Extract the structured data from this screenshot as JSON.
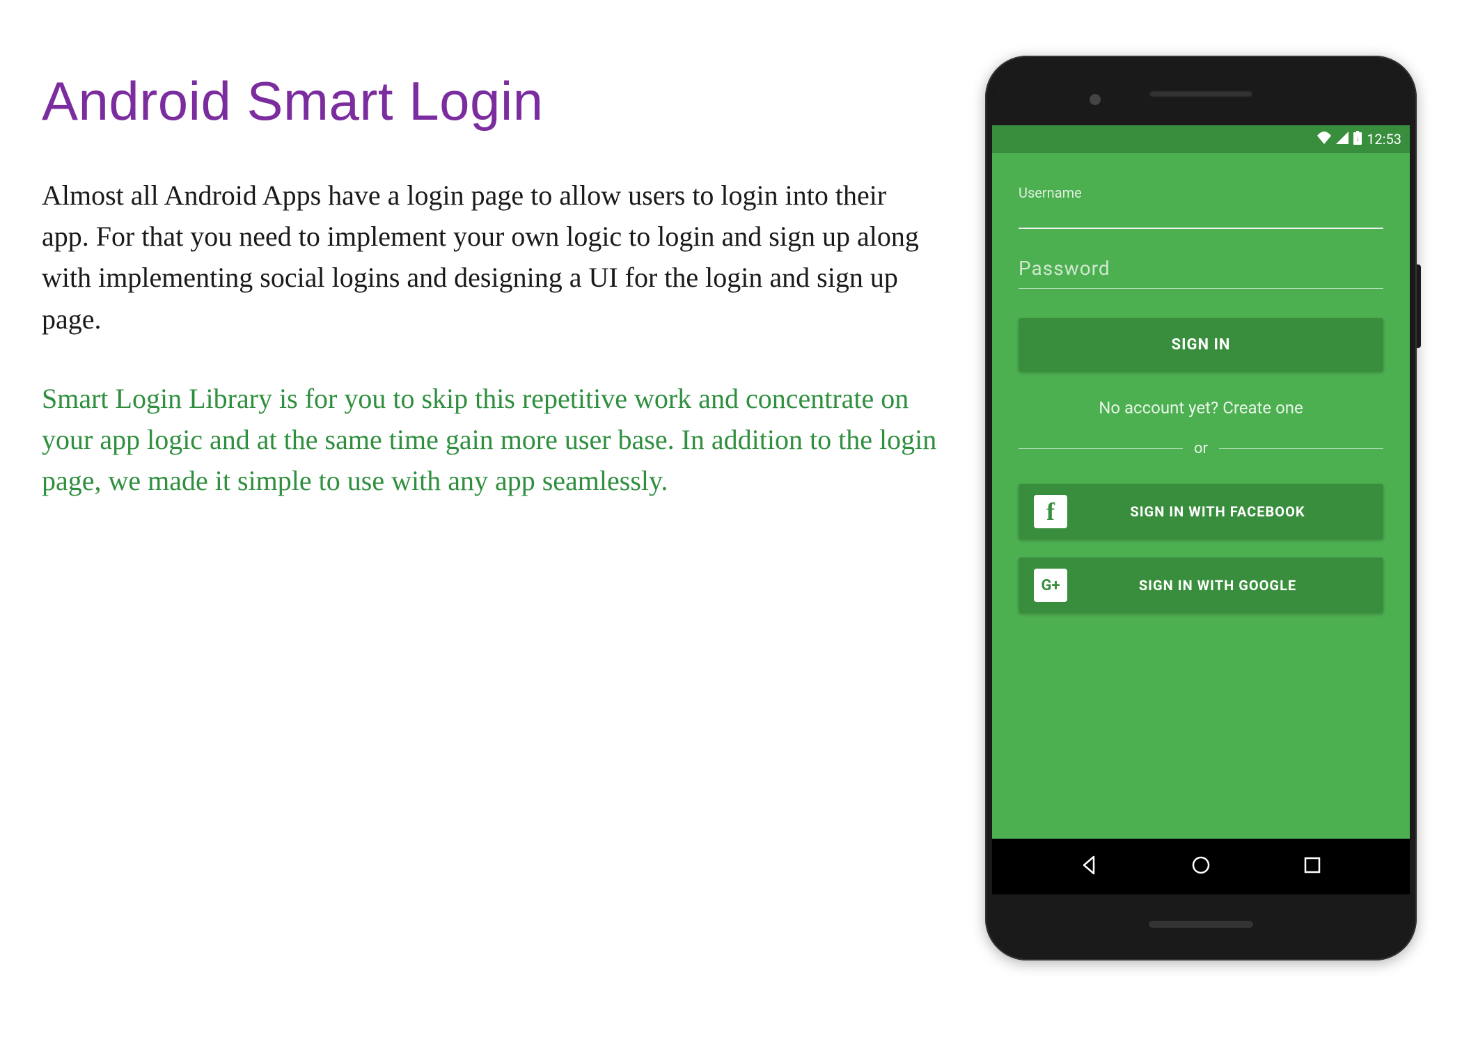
{
  "title": "Android Smart Login",
  "para1": "Almost all Android Apps have a login page to allow users to login into their app. For that you need to implement your own logic to login and sign up along with implementing social logins and designing a UI for the login and sign up page.",
  "para2": "Smart Login Library is for you to skip this repetitive work and concentrate on your app logic and at the same time gain more user base. In addition to the login page, we made it simple to use with any app seamlessly.",
  "phone": {
    "status_time": "12:53",
    "login": {
      "username_label": "Username",
      "password_placeholder": "Password",
      "signin_label": "SIGN IN",
      "create_account_text": "No account yet? Create one",
      "divider_text": "or",
      "facebook_label": "SIGN IN WITH FACEBOOK",
      "google_label": "SIGN IN WITH GOOGLE",
      "facebook_icon_letter": "f",
      "google_icon_text": "G+"
    }
  },
  "colors": {
    "title": "#7b2c9e",
    "accent_green": "#2f8f3e",
    "app_bg": "#4CAF50",
    "app_dark": "#388E3C"
  }
}
